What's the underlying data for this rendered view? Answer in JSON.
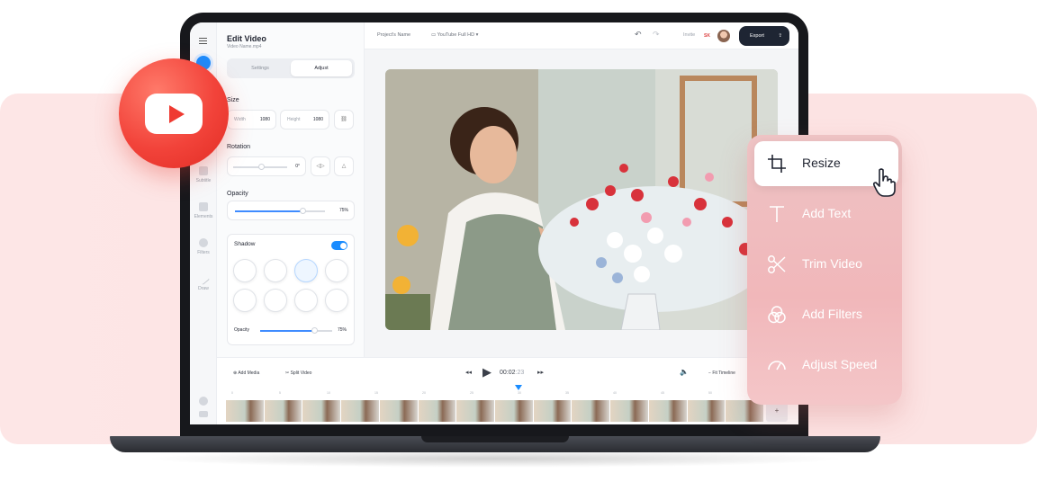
{
  "sidebar": {
    "items": [
      {
        "label": "Subtitle",
        "icon": "subtitle-icon"
      },
      {
        "label": "Elements",
        "icon": "elements-icon"
      },
      {
        "label": "Filters",
        "icon": "filters-icon"
      },
      {
        "label": "Draw",
        "icon": "draw-icon"
      }
    ]
  },
  "panel": {
    "title": "Edit Video",
    "filename": "Video Name.mp4",
    "tabs": [
      "Settings",
      "Adjust"
    ],
    "active_tab": "Adjust",
    "size": {
      "label": "Size",
      "width_label": "Width",
      "width_value": "1080",
      "height_label": "Height",
      "height_value": "1080"
    },
    "rotation": {
      "label": "Rotation",
      "value": "0°"
    },
    "opacity": {
      "label": "Opacity",
      "value": "75%",
      "level": 0.75
    },
    "shadow": {
      "label": "Shadow",
      "enabled": true,
      "opacity_label": "Opacity",
      "opacity_value": "75%",
      "opacity_level": 0.75
    }
  },
  "topbar": {
    "project_name": "Project's Name",
    "format": "YouTube Full HD",
    "invite": "Invite",
    "user_initials": "SK",
    "export": "Export"
  },
  "timeline": {
    "add_media": "Add Media",
    "split_video": "Split Video",
    "time": "00:02",
    "time_fraction": ":23",
    "fit_timeline": "Fit Timeline",
    "ticks": [
      "0",
      "5",
      "10",
      "15",
      "20",
      "25",
      "30",
      "35",
      "40",
      "45",
      "50"
    ],
    "add_button": "+"
  },
  "floating_menu": {
    "items": [
      {
        "label": "Resize",
        "icon": "crop-icon",
        "active": true
      },
      {
        "label": "Add Text",
        "icon": "text-icon",
        "active": false
      },
      {
        "label": "Trim Video",
        "icon": "scissors-icon",
        "active": false
      },
      {
        "label": "Add Filters",
        "icon": "filters-icon",
        "active": false
      },
      {
        "label": "Adjust Speed",
        "icon": "speedometer-icon",
        "active": false
      }
    ]
  },
  "colors": {
    "accent": "#1a8cff",
    "youtube_red": "#ef3a31",
    "menu_pink": "#f1b7ba",
    "export_dark": "#1e2533"
  }
}
